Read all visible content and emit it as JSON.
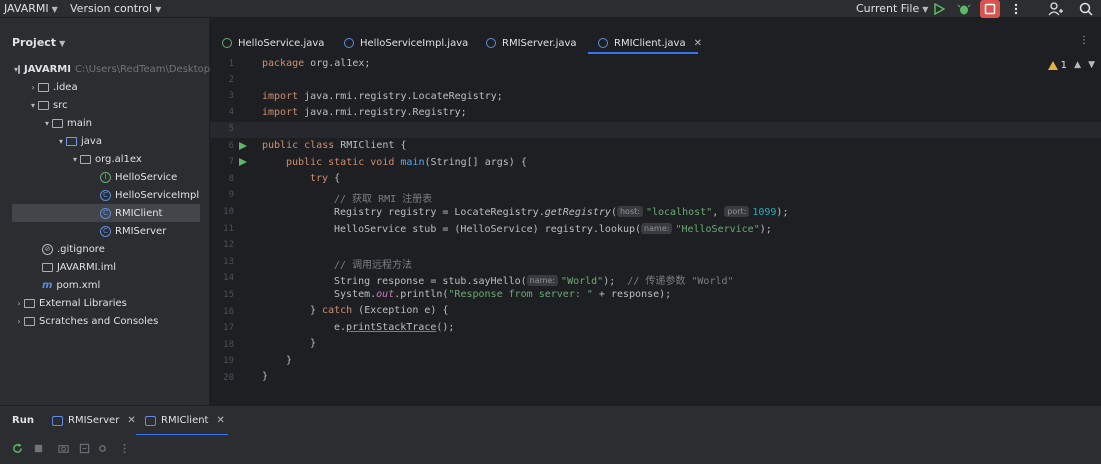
{
  "titlebar": {
    "project_name": "JAVARMI",
    "vcs_label": "Version control",
    "run_config": "Current File"
  },
  "project_panel": {
    "header": "Project",
    "tree": [
      {
        "label": "JAVARMI",
        "path": "C:\\Users\\RedTeam\\Desktop",
        "kind": "module"
      },
      {
        "label": ".idea",
        "kind": "folder"
      },
      {
        "label": "src",
        "kind": "folder"
      },
      {
        "label": "main",
        "kind": "folder"
      },
      {
        "label": "java",
        "kind": "source-folder"
      },
      {
        "label": "org.al1ex",
        "kind": "package"
      },
      {
        "label": "HelloService",
        "kind": "interface"
      },
      {
        "label": "HelloServiceImpl",
        "kind": "class"
      },
      {
        "label": "RMIClient",
        "kind": "class",
        "selected": true
      },
      {
        "label": "RMIServer",
        "kind": "class"
      },
      {
        "label": ".gitignore",
        "kind": "file"
      },
      {
        "label": "JAVARMI.iml",
        "kind": "file"
      },
      {
        "label": "pom.xml",
        "kind": "maven"
      },
      {
        "label": "External Libraries",
        "kind": "library"
      },
      {
        "label": "Scratches and Consoles",
        "kind": "scratch"
      }
    ]
  },
  "editor_tabs": [
    {
      "label": "HelloService.java",
      "icon": "interface-icon"
    },
    {
      "label": "HelloServiceImpl.java",
      "icon": "class-icon"
    },
    {
      "label": "RMIServer.java",
      "icon": "class-icon"
    },
    {
      "label": "RMIClient.java",
      "icon": "class-icon",
      "active": true
    }
  ],
  "editor": {
    "warning_count": "1",
    "line_numbers": [
      "1",
      "2",
      "3",
      "4",
      "5",
      "6",
      "7",
      "8",
      "9",
      "10",
      "11",
      "12",
      "13",
      "14",
      "15",
      "16",
      "17",
      "18",
      "19",
      "20"
    ],
    "code": {
      "l1_kw": "package",
      "l1_rest": " org.al1ex;",
      "l3_kw": "import",
      "l3_rest": " java.rmi.registry.LocateRegistry;",
      "l4_kw": "import",
      "l4_rest": " java.rmi.registry.Registry;",
      "l6_kw": "public class",
      "l6_rest": " RMIClient {",
      "l7_kw": "public static void",
      "l7_fn": "main",
      "l7_rest": "(String[] args) {",
      "l8_kw": "try",
      "l8_rest": " {",
      "l9_cmt": "// 获取 RMI 注册表",
      "l10_a": "Registry registry = LocateRegistry.",
      "l10_fn": "getRegistry",
      "l10_b": "(",
      "l10_hint1": "host:",
      "l10_str": "\"localhost\"",
      "l10_c": ", ",
      "l10_hint2": "port:",
      "l10_num": "1099",
      "l10_d": ");",
      "l11_a": "HelloService stub = (HelloService) registry.lookup(",
      "l11_hint": "name:",
      "l11_str": "\"HelloService\"",
      "l11_b": ");",
      "l13_cmt": "// 调用远程方法",
      "l14_a": "String response = stub.sayHello(",
      "l14_hint": "name:",
      "l14_str": "\"World\"",
      "l14_b": ");  ",
      "l14_cmt": "// 传递参数 \"World\"",
      "l15_a": "System.",
      "l15_fld": "out",
      "l15_b": ".println(",
      "l15_str": "\"Response from server: \"",
      "l15_c": " + response);",
      "l16_a": "} ",
      "l16_kw": "catch",
      "l16_b": " (Exception e) {",
      "l17_a": "e.",
      "l17_fn": "printStackTrace",
      "l17_b": "();",
      "l18": "}",
      "l19": "}",
      "l20": "}"
    }
  },
  "run_panel": {
    "label": "Run",
    "tabs": [
      {
        "label": "RMIServer"
      },
      {
        "label": "RMIClient",
        "active": true
      }
    ]
  },
  "colors": {
    "accent": "#3574f0",
    "stop_button": "#d9534f",
    "run_green": "#5fb865"
  }
}
